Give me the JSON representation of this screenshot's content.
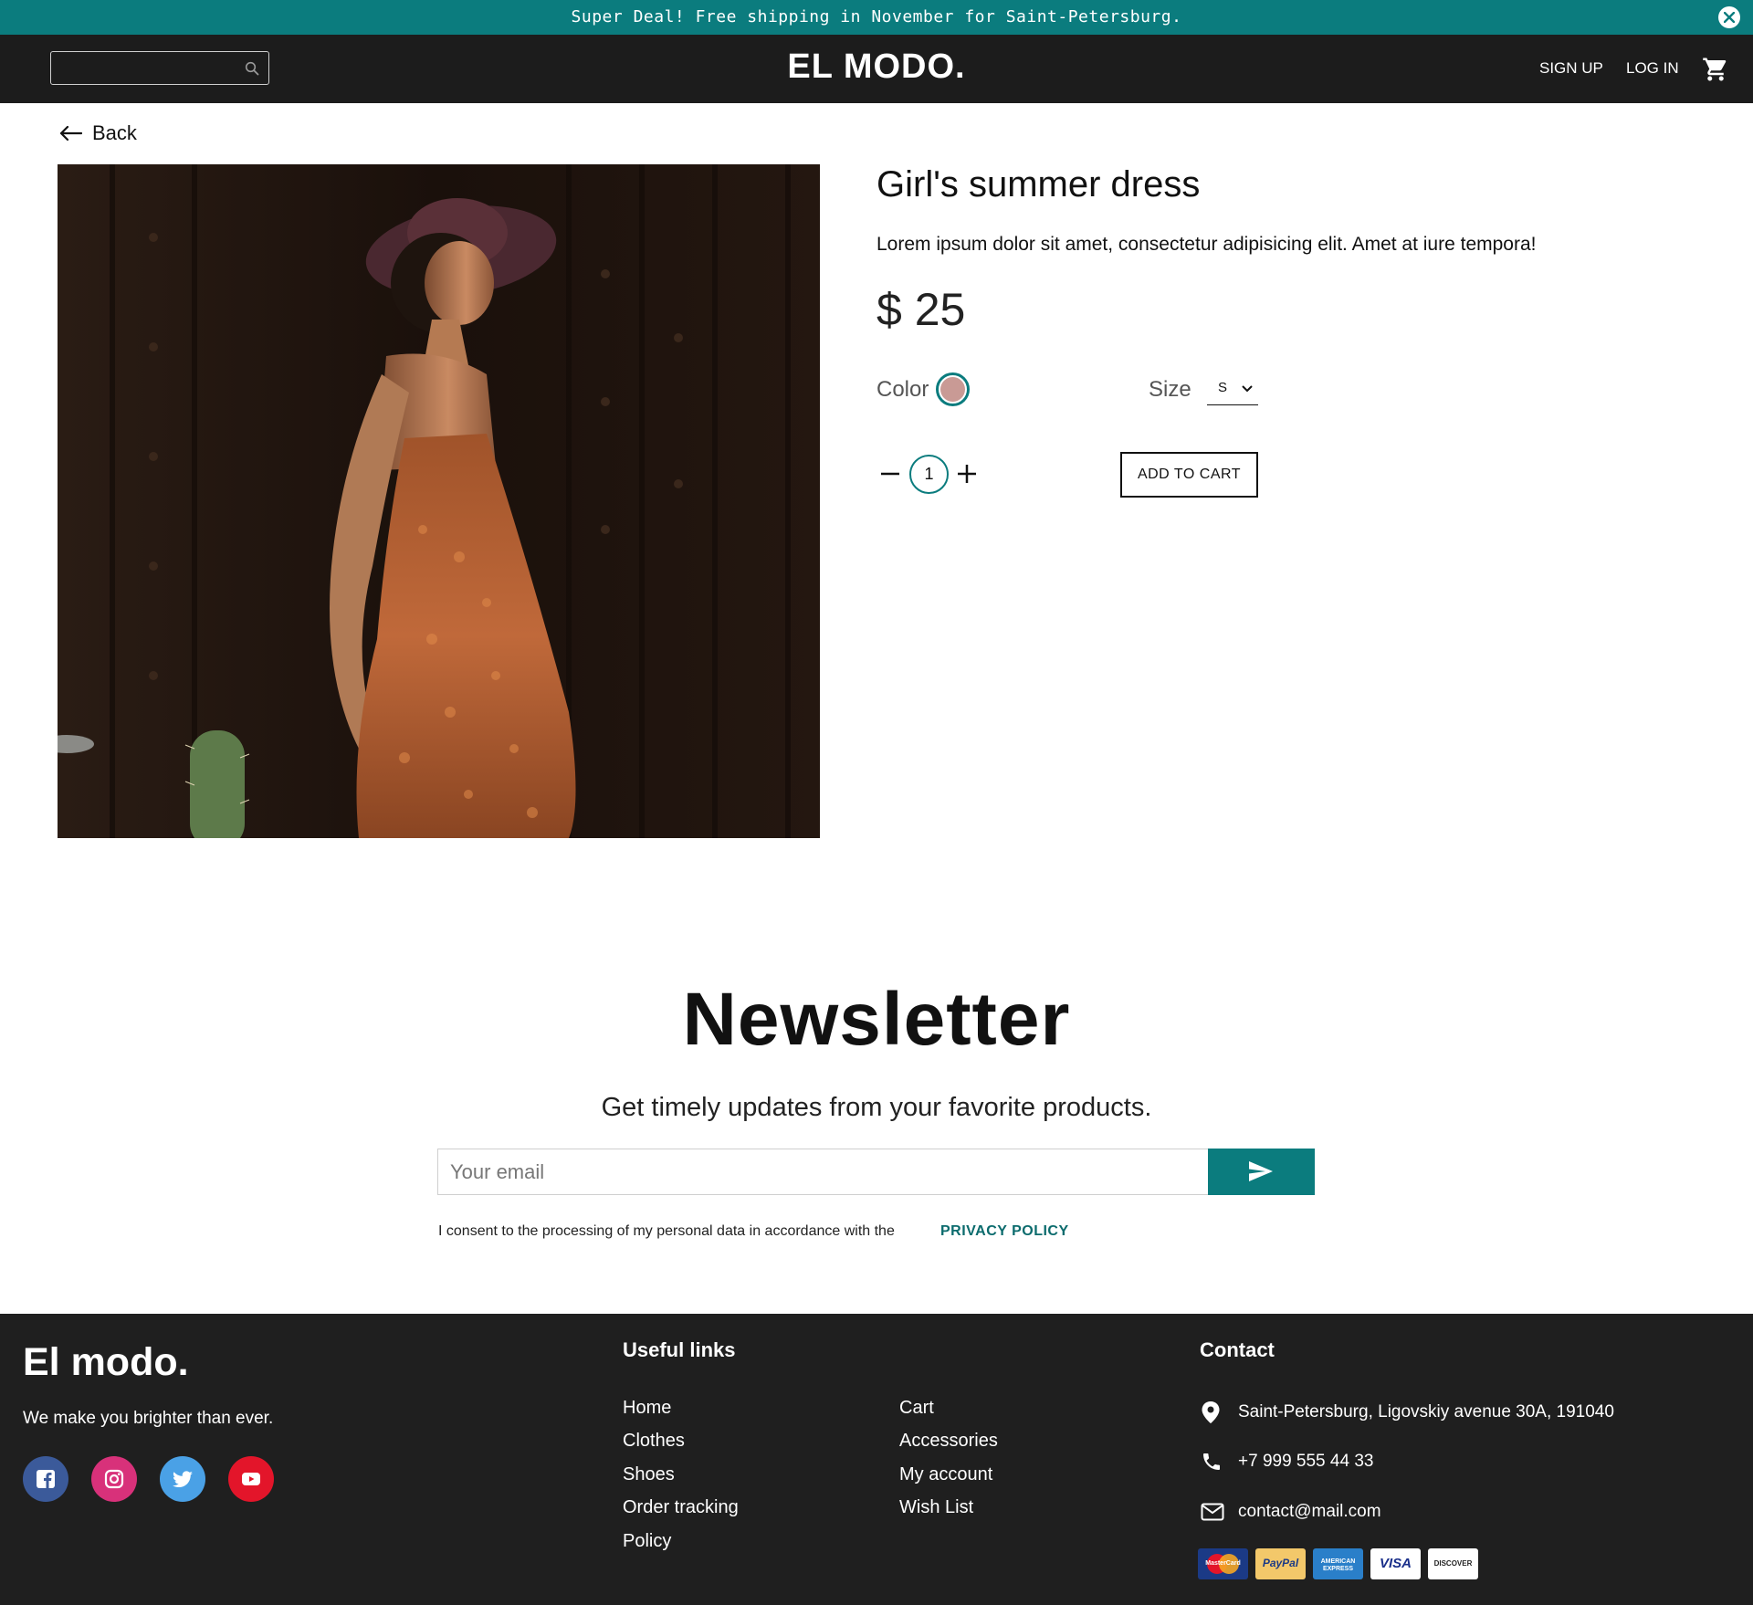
{
  "promo": {
    "text": "Super Deal! Free shipping in November for Saint-Petersburg.",
    "close_icon": "close-icon"
  },
  "header": {
    "search": {
      "value": "",
      "placeholder": ""
    },
    "logo": "EL MODO.",
    "signup_label": "SIGN UP",
    "login_label": "LOG IN",
    "cart_icon": "cart-icon"
  },
  "back_label": "Back",
  "product": {
    "title": "Girl's summer dress",
    "description": "Lorem ipsum dolor sit amet, consectetur adipisicing elit. Amet at iure tempora!",
    "price": "$ 25",
    "color_label": "Color",
    "color_value": "#c99a95",
    "size_label": "Size",
    "size_value": "S",
    "quantity": "1",
    "add_to_cart_label": "ADD TO CART"
  },
  "newsletter": {
    "title": "Newsletter",
    "subtitle": "Get timely updates from your favorite products.",
    "email_placeholder": "Your email",
    "email_value": "",
    "consent_text": "I consent to the processing of my personal data in accordance with the",
    "privacy_label": "PRIVACY POLICY"
  },
  "footer": {
    "logo": "El modo.",
    "tagline": "We make you brighter than ever.",
    "social": [
      "facebook-icon",
      "instagram-icon",
      "twitter-icon",
      "youtube-icon"
    ],
    "useful_links_heading": "Useful links",
    "links_col1": [
      "Home",
      "Clothes",
      "Shoes",
      "Order tracking",
      "Policy"
    ],
    "links_col2": [
      "Cart",
      "Accessories",
      "My account",
      "Wish List"
    ],
    "contact_heading": "Contact",
    "address": "Saint-Petersburg, Ligovskiy avenue 30A, 191040",
    "phone": "+7 999 555 44 33",
    "email": "contact@mail.com",
    "payments": [
      "MasterCard",
      "PayPal",
      "AMERICAN EXPRESS",
      "VISA",
      "DISCOVER"
    ]
  },
  "colors": {
    "accent": "#0b7c7e",
    "dark": "#1c1c1c",
    "footer": "#1f1f1f"
  }
}
